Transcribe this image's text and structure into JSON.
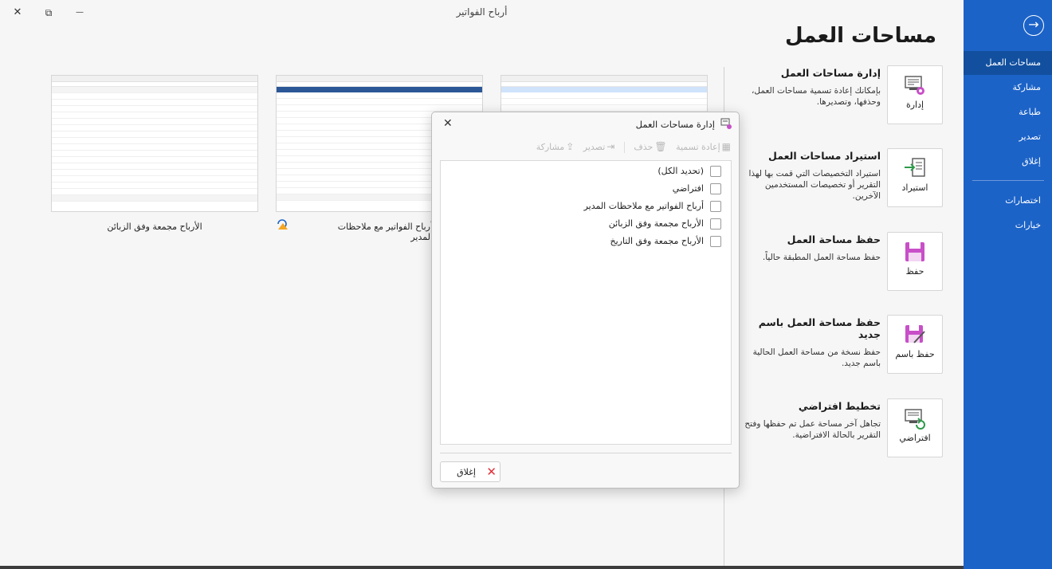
{
  "window": {
    "title": "أرباح الفواتير",
    "close_glyph": "✕",
    "restore_glyph": "⧉",
    "minimize_glyph": "—"
  },
  "nav": {
    "back_glyph": "→",
    "items": [
      {
        "label": "مساحات العمل"
      },
      {
        "label": "مشاركة"
      },
      {
        "label": "طباعة"
      },
      {
        "label": "تصدير"
      },
      {
        "label": "إغلاق"
      },
      {
        "label": "اختصارات"
      },
      {
        "label": "خيارات"
      }
    ]
  },
  "page": {
    "heading": "مساحات العمل"
  },
  "actions": [
    {
      "button": "إدارة",
      "title": "إدارة مساحات العمل",
      "desc": "بإمكانك إعادة تسمية مساحات العمل، وحذفها، وتصديرها."
    },
    {
      "button": "استيراد",
      "title": "استيراد مساحات العمل",
      "desc": "استيراد التخصيصات التي قمت بها لهذا التقرير أو تخصيصات المستخدمين الآخرين."
    },
    {
      "button": "حفظ",
      "title": "حفظ مساحة العمل",
      "desc": "حفظ مساحة العمل المطبقة حالياً."
    },
    {
      "button": "حفظ باسم",
      "title": "حفظ مساحة العمل باسم جديد",
      "desc": "حفظ نسخة من مساحة العمل الحالية باسم جديد."
    },
    {
      "button": "افتراضي",
      "title": "تخطيط افتراضي",
      "desc": "تجاهل آخر مساحة عمل تم حفظها وفتح التقرير بالحالة الافتراضية."
    }
  ],
  "thumbnails": [
    {
      "caption": "الأرباح مجمعة وفق الزبائن"
    },
    {
      "caption": "أرباح الفواتير مع ملاحظات المدير"
    }
  ],
  "dialog": {
    "title": "إدارة مساحات العمل",
    "close_glyph": "✕",
    "toolbar": {
      "rename": "إعادة تسمية",
      "delete": "حذف",
      "export": "تصدير",
      "share": "مشاركة"
    },
    "items": [
      {
        "label": "(تحديد الكل)",
        "checked": false
      },
      {
        "label": "افتراضي",
        "checked": false
      },
      {
        "label": "أرباح الفواتير مع ملاحظات المدير",
        "checked": false
      },
      {
        "label": "الأرباح مجمعة وفق الزبائن",
        "checked": false
      },
      {
        "label": "الأرباح مجمعة وفق التاريخ",
        "checked": false
      }
    ],
    "close_button": "إغلاق"
  },
  "colors": {
    "nav_bg": "#1c63c8",
    "nav_active": "#12509f",
    "icon_accent": "#c84fc8",
    "close_red": "#e0303a"
  }
}
